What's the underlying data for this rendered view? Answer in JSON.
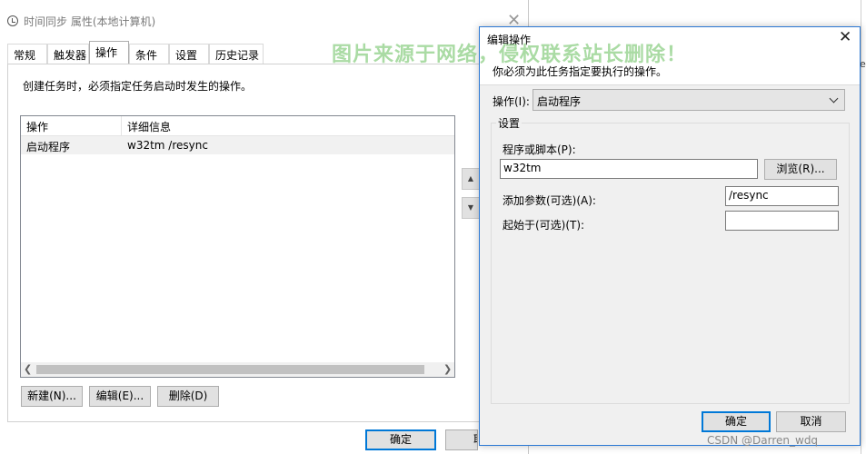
{
  "background_window": {
    "title": "时间同步 属性(本地计算机)",
    "close_glyph": "✕",
    "tabs": [
      "常规",
      "触发器",
      "操作",
      "条件",
      "设置",
      "历史记录"
    ],
    "active_tab_index": 2,
    "description": "创建任务时，必须指定任务启动时发生的操作。",
    "table": {
      "headers": [
        "操作",
        "详细信息"
      ],
      "rows": [
        {
          "action": "启动程序",
          "details": "w32tm /resync"
        }
      ]
    },
    "buttons": {
      "new": "新建(N)...",
      "edit": "编辑(E)...",
      "delete": "删除(D)",
      "ok": "确定",
      "cancel_partial": "取"
    }
  },
  "dialog": {
    "title": "编辑操作",
    "close_glyph": "✕",
    "description": "你必须为此任务指定要执行的操作。",
    "action_label": "操作(I):",
    "action_value": "启动程序",
    "settings_legend": "设置",
    "program_label": "程序或脚本(P):",
    "program_value": "w32tm",
    "browse_button": "浏览(R)...",
    "args_label": "添加参数(可选)(A):",
    "args_value": "/resync",
    "start_label": "起始于(可选)(T):",
    "start_value": "",
    "ok_button": "确定",
    "cancel_button": "取消"
  },
  "overlay": {
    "watermark": "图片来源于网络，侵权联系站长删除！",
    "csdn_credit": "CSDN @Darren_wdq"
  },
  "edge_text": "er"
}
